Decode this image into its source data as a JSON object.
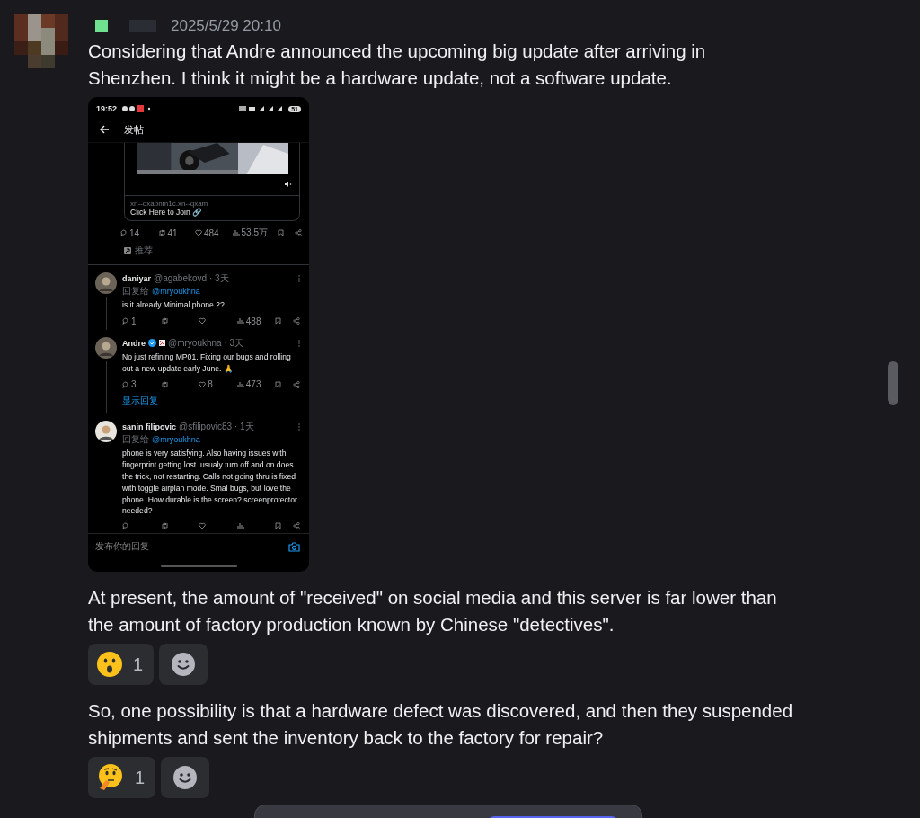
{
  "message": {
    "timestamp": "2025/5/29 20:10",
    "paragraphs": [
      {
        "text": "Considering that Andre announced the upcoming big update after arriving in Shenzhen. I think it might be a hardware update, not a software update.",
        "attachment": {
          "time": "19:52",
          "battery": "51",
          "title": "发帖",
          "post": {
            "domain": "xn--oxapnm1c.xn--qxam",
            "link": "Click Here to Join 🔗",
            "stats": {
              "reply": "14",
              "retweet": "41",
              "like": "484",
              "views": "53.5万"
            },
            "tag": "推荐"
          },
          "replies": [
            {
              "name": "daniyar",
              "verified": false,
              "handle": "@agabekovd · 3天",
              "reply_to_label": "回复给",
              "reply_to": "@mryoukhna",
              "text": "is it already Minimal phone 2?",
              "stats": {
                "reply": "1",
                "views": "488"
              }
            },
            {
              "name": "Andre",
              "verified": true,
              "handle": "@mryoukhna · 3天",
              "text": "No just refining MP01. Fixing our bugs and rolling out a new update early June. 🙏",
              "stats": {
                "reply": "3",
                "like": "8",
                "views": "473"
              },
              "show_replies": "显示回复"
            },
            {
              "name": "sanin filipovic",
              "verified": false,
              "handle": "@sfilipovic83 · 1天",
              "reply_to_label": "回复给",
              "reply_to": "@mryoukhna",
              "text": "phone is very satisfying. Also having issues with fingerprint getting lost. usualy turn off and on does the trick, not restarting. Calls not going thru is fixed with toggle airplan mode. Smal bugs, but love the phone. How durable is the screen? screenprotector needed?"
            }
          ],
          "reply_placeholder": "发布你的回复"
        }
      },
      {
        "text": "At present, the amount of \"received\" on social media and this server is far lower than the amount of factory production known by Chinese \"detectives\".",
        "reactions": [
          {
            "kind": "surprised",
            "count": "1"
          }
        ]
      },
      {
        "text": "So, one possibility is that a hardware defect was discovered, and then they suspended shipments and sent the inventory back to the factory for repair?",
        "reactions": [
          {
            "kind": "thinking",
            "count": "1"
          }
        ]
      }
    ]
  }
}
